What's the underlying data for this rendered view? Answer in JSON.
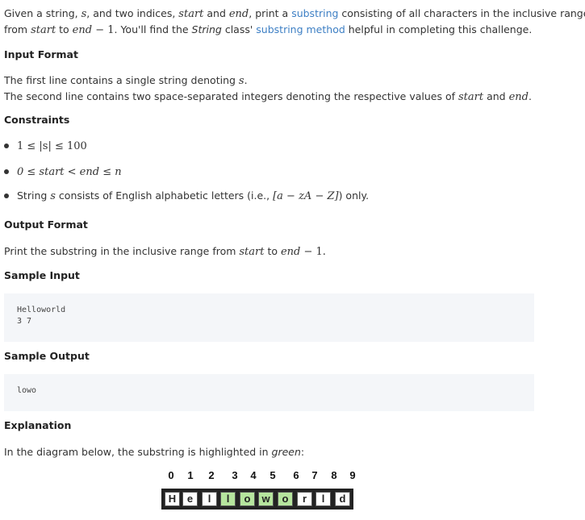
{
  "intro": {
    "t1": "Given a string, ",
    "s": "s",
    "t2": ", and two indices, ",
    "start": "start",
    "t3": " and ",
    "end": "end",
    "t4": ", print a ",
    "link_substring": "substring",
    "t5": " consisting of all characters in the inclusive range",
    "t6": "from ",
    "start2": "start",
    "t7": " to ",
    "end2": "end",
    "minus_one": " − 1",
    "t8": ". You'll find the ",
    "string_class": "String",
    "t9": " class' ",
    "link_method": "substring method",
    "t10": " helpful in completing this challenge."
  },
  "input_format": {
    "heading": "Input Format",
    "line1a": "The first line contains a single string denoting ",
    "line1s": "s",
    "line1b": ".",
    "line2a": "The second line contains two space-separated integers denoting the respective values of ",
    "line2start": "start",
    "line2and": " and ",
    "line2end": "end",
    "line2b": "."
  },
  "constraints": {
    "heading": "Constraints",
    "c1": "1 ≤ |s| ≤ 100",
    "c2": "0 ≤ start < end ≤ n",
    "c3a": "String ",
    "c3s": "s",
    "c3b": " consists of English alphabetic letters (i.e., ",
    "c3range": "[a − zA − Z]",
    "c3c": ") only."
  },
  "output_format": {
    "heading": "Output Format",
    "a": "Print the substring in the inclusive range from ",
    "start": "start",
    "to": " to ",
    "end": "end",
    "minus": " − 1."
  },
  "sample_input": {
    "heading": "Sample Input",
    "code": "Helloworld\n3 7"
  },
  "sample_output": {
    "heading": "Sample Output",
    "code": "lowo"
  },
  "explanation": {
    "heading": "Explanation",
    "a": "In the diagram below, the substring is highlighted in ",
    "green": "green",
    "b": ":"
  },
  "diagram": {
    "indices": [
      "0",
      "1",
      "2",
      "3",
      "4",
      "5",
      "6",
      "7",
      "8",
      "9"
    ],
    "letters": [
      "H",
      "e",
      "l",
      "l",
      "o",
      "w",
      "o",
      "r",
      "l",
      "d"
    ],
    "highlighted": [
      false,
      false,
      false,
      true,
      true,
      true,
      true,
      false,
      false,
      false
    ],
    "highlight_color": "#b6e59e"
  }
}
